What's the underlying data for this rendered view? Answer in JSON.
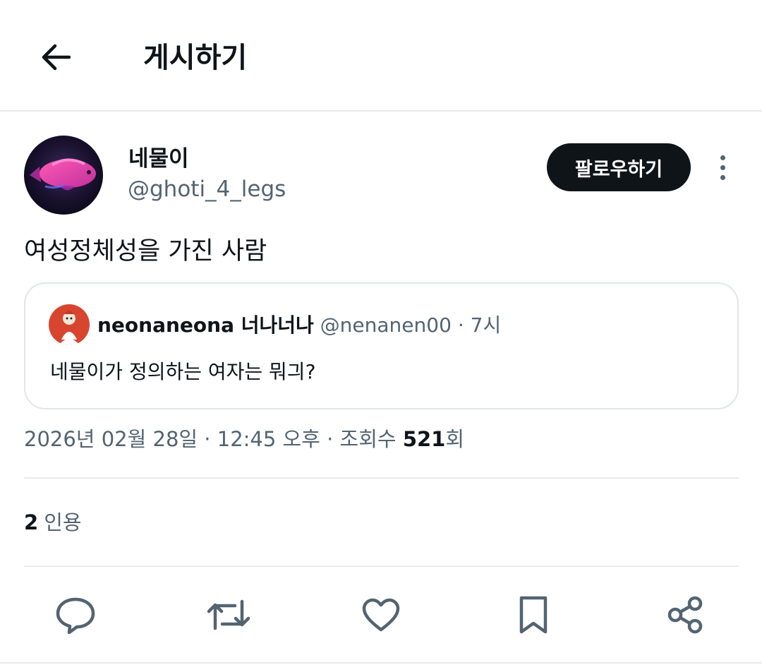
{
  "header": {
    "title": "게시하기"
  },
  "author": {
    "name": "네물이",
    "handle": "@ghoti_4_legs",
    "avatar_icon": "pink-fish-avatar"
  },
  "follow_button": {
    "label": "팔로우하기"
  },
  "post": {
    "text": "여성정체성을 가진 사람"
  },
  "quote": {
    "avatar_icon": "character-avatar",
    "name": "neonaneona 너나너나",
    "handle": "@nenanen00",
    "separator": "·",
    "time": "7시",
    "text": "네물이가 정의하는 여자는 뭐긔?"
  },
  "meta": {
    "datetime": "2026년 02월 28일 · 12:45 오후 · 조회수 ",
    "views_count": "521",
    "views_suffix": "회"
  },
  "quotes": {
    "count": "2",
    "label": "인용"
  },
  "actions": [
    "reply-icon",
    "repost-icon",
    "like-icon",
    "bookmark-icon",
    "share-icon"
  ],
  "colors": {
    "text": "#0f1419",
    "secondary": "#536471",
    "border": "#e7e9ea"
  }
}
